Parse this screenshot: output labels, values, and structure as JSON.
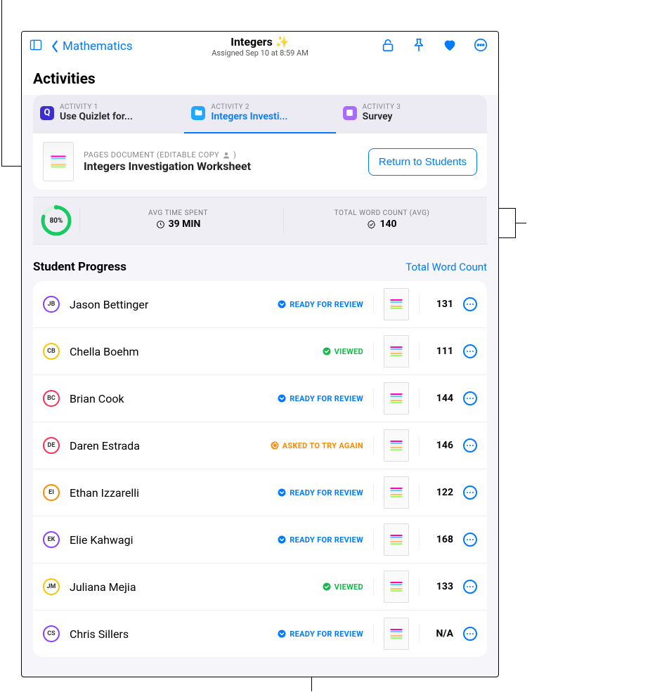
{
  "header": {
    "back_label": "Mathematics",
    "title": "Integers ✨",
    "subtitle": "Assigned Sep 10 at 8:59 AM"
  },
  "section_title": "Activities",
  "tabs": [
    {
      "eyebrow": "ACTIVITY 1",
      "label": "Use Quizlet for...",
      "icon_bg": "#3c2fd1",
      "icon_fg": "#fff",
      "selected": false,
      "icon": "Q"
    },
    {
      "eyebrow": "ACTIVITY 2",
      "label": "Integers Investi...",
      "icon_bg": "#1fa8ff",
      "icon_fg": "#fff",
      "selected": true,
      "icon": "folder"
    },
    {
      "eyebrow": "ACTIVITY 3",
      "label": "Survey",
      "icon_bg": "#a96bff",
      "icon_fg": "#fff",
      "selected": false,
      "icon": "survey"
    }
  ],
  "document": {
    "eyebrow": "PAGES DOCUMENT (EDITABLE COPY",
    "eyebrow_suffix": ")",
    "title": "Integers Investigation Worksheet",
    "return_label": "Return to Students"
  },
  "stats": {
    "percent": "80%",
    "time_label": "AVG TIME SPENT",
    "time_value": "39 MIN",
    "words_label": "TOTAL WORD COUNT (AVG)",
    "words_value": "140"
  },
  "progress": {
    "heading": "Student Progress",
    "link": "Total Word Count"
  },
  "status_types": {
    "ready": {
      "text": "READY FOR REVIEW",
      "color": "#007aff",
      "glyph": "down"
    },
    "viewed": {
      "text": "VIEWED",
      "color": "#18b74d",
      "glyph": "check"
    },
    "retry": {
      "text": "ASKED TO TRY AGAIN",
      "color": "#ff8a00",
      "glyph": "redo"
    }
  },
  "students": [
    {
      "initials": "JB",
      "ring": "#8a3ffc",
      "name": "Jason Bettinger",
      "status": "ready",
      "count": "131"
    },
    {
      "initials": "CB",
      "ring": "#f7c600",
      "name": "Chella Boehm",
      "status": "viewed",
      "count": "111"
    },
    {
      "initials": "BC",
      "ring": "#ff2d55",
      "name": "Brian Cook",
      "status": "ready",
      "count": "144"
    },
    {
      "initials": "DE",
      "ring": "#ff2d55",
      "name": "Daren Estrada",
      "status": "retry",
      "count": "146"
    },
    {
      "initials": "EI",
      "ring": "#ff8a00",
      "name": "Ethan Izzarelli",
      "status": "ready",
      "count": "122"
    },
    {
      "initials": "EK",
      "ring": "#8a3ffc",
      "name": "Elie Kahwagi",
      "status": "ready",
      "count": "168"
    },
    {
      "initials": "JM",
      "ring": "#f7c600",
      "name": "Juliana Mejia",
      "status": "viewed",
      "count": "133"
    },
    {
      "initials": "CS",
      "ring": "#8a3ffc",
      "name": "Chris Sillers",
      "status": "ready",
      "count": "N/A"
    }
  ]
}
